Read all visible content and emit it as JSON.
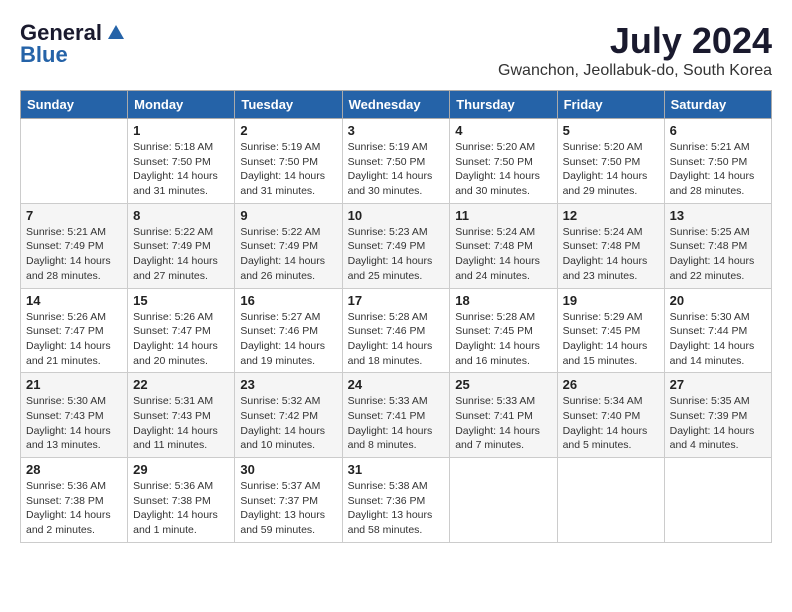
{
  "logo": {
    "general": "General",
    "blue": "Blue"
  },
  "title": {
    "month": "July 2024",
    "location": "Gwanchon, Jeollabuk-do, South Korea"
  },
  "weekdays": [
    "Sunday",
    "Monday",
    "Tuesday",
    "Wednesday",
    "Thursday",
    "Friday",
    "Saturday"
  ],
  "weeks": [
    [
      {
        "day": "",
        "info": ""
      },
      {
        "day": "1",
        "info": "Sunrise: 5:18 AM\nSunset: 7:50 PM\nDaylight: 14 hours\nand 31 minutes."
      },
      {
        "day": "2",
        "info": "Sunrise: 5:19 AM\nSunset: 7:50 PM\nDaylight: 14 hours\nand 31 minutes."
      },
      {
        "day": "3",
        "info": "Sunrise: 5:19 AM\nSunset: 7:50 PM\nDaylight: 14 hours\nand 30 minutes."
      },
      {
        "day": "4",
        "info": "Sunrise: 5:20 AM\nSunset: 7:50 PM\nDaylight: 14 hours\nand 30 minutes."
      },
      {
        "day": "5",
        "info": "Sunrise: 5:20 AM\nSunset: 7:50 PM\nDaylight: 14 hours\nand 29 minutes."
      },
      {
        "day": "6",
        "info": "Sunrise: 5:21 AM\nSunset: 7:50 PM\nDaylight: 14 hours\nand 28 minutes."
      }
    ],
    [
      {
        "day": "7",
        "info": "Sunrise: 5:21 AM\nSunset: 7:49 PM\nDaylight: 14 hours\nand 28 minutes."
      },
      {
        "day": "8",
        "info": "Sunrise: 5:22 AM\nSunset: 7:49 PM\nDaylight: 14 hours\nand 27 minutes."
      },
      {
        "day": "9",
        "info": "Sunrise: 5:22 AM\nSunset: 7:49 PM\nDaylight: 14 hours\nand 26 minutes."
      },
      {
        "day": "10",
        "info": "Sunrise: 5:23 AM\nSunset: 7:49 PM\nDaylight: 14 hours\nand 25 minutes."
      },
      {
        "day": "11",
        "info": "Sunrise: 5:24 AM\nSunset: 7:48 PM\nDaylight: 14 hours\nand 24 minutes."
      },
      {
        "day": "12",
        "info": "Sunrise: 5:24 AM\nSunset: 7:48 PM\nDaylight: 14 hours\nand 23 minutes."
      },
      {
        "day": "13",
        "info": "Sunrise: 5:25 AM\nSunset: 7:48 PM\nDaylight: 14 hours\nand 22 minutes."
      }
    ],
    [
      {
        "day": "14",
        "info": "Sunrise: 5:26 AM\nSunset: 7:47 PM\nDaylight: 14 hours\nand 21 minutes."
      },
      {
        "day": "15",
        "info": "Sunrise: 5:26 AM\nSunset: 7:47 PM\nDaylight: 14 hours\nand 20 minutes."
      },
      {
        "day": "16",
        "info": "Sunrise: 5:27 AM\nSunset: 7:46 PM\nDaylight: 14 hours\nand 19 minutes."
      },
      {
        "day": "17",
        "info": "Sunrise: 5:28 AM\nSunset: 7:46 PM\nDaylight: 14 hours\nand 18 minutes."
      },
      {
        "day": "18",
        "info": "Sunrise: 5:28 AM\nSunset: 7:45 PM\nDaylight: 14 hours\nand 16 minutes."
      },
      {
        "day": "19",
        "info": "Sunrise: 5:29 AM\nSunset: 7:45 PM\nDaylight: 14 hours\nand 15 minutes."
      },
      {
        "day": "20",
        "info": "Sunrise: 5:30 AM\nSunset: 7:44 PM\nDaylight: 14 hours\nand 14 minutes."
      }
    ],
    [
      {
        "day": "21",
        "info": "Sunrise: 5:30 AM\nSunset: 7:43 PM\nDaylight: 14 hours\nand 13 minutes."
      },
      {
        "day": "22",
        "info": "Sunrise: 5:31 AM\nSunset: 7:43 PM\nDaylight: 14 hours\nand 11 minutes."
      },
      {
        "day": "23",
        "info": "Sunrise: 5:32 AM\nSunset: 7:42 PM\nDaylight: 14 hours\nand 10 minutes."
      },
      {
        "day": "24",
        "info": "Sunrise: 5:33 AM\nSunset: 7:41 PM\nDaylight: 14 hours\nand 8 minutes."
      },
      {
        "day": "25",
        "info": "Sunrise: 5:33 AM\nSunset: 7:41 PM\nDaylight: 14 hours\nand 7 minutes."
      },
      {
        "day": "26",
        "info": "Sunrise: 5:34 AM\nSunset: 7:40 PM\nDaylight: 14 hours\nand 5 minutes."
      },
      {
        "day": "27",
        "info": "Sunrise: 5:35 AM\nSunset: 7:39 PM\nDaylight: 14 hours\nand 4 minutes."
      }
    ],
    [
      {
        "day": "28",
        "info": "Sunrise: 5:36 AM\nSunset: 7:38 PM\nDaylight: 14 hours\nand 2 minutes."
      },
      {
        "day": "29",
        "info": "Sunrise: 5:36 AM\nSunset: 7:38 PM\nDaylight: 14 hours\nand 1 minute."
      },
      {
        "day": "30",
        "info": "Sunrise: 5:37 AM\nSunset: 7:37 PM\nDaylight: 13 hours\nand 59 minutes."
      },
      {
        "day": "31",
        "info": "Sunrise: 5:38 AM\nSunset: 7:36 PM\nDaylight: 13 hours\nand 58 minutes."
      },
      {
        "day": "",
        "info": ""
      },
      {
        "day": "",
        "info": ""
      },
      {
        "day": "",
        "info": ""
      }
    ]
  ]
}
